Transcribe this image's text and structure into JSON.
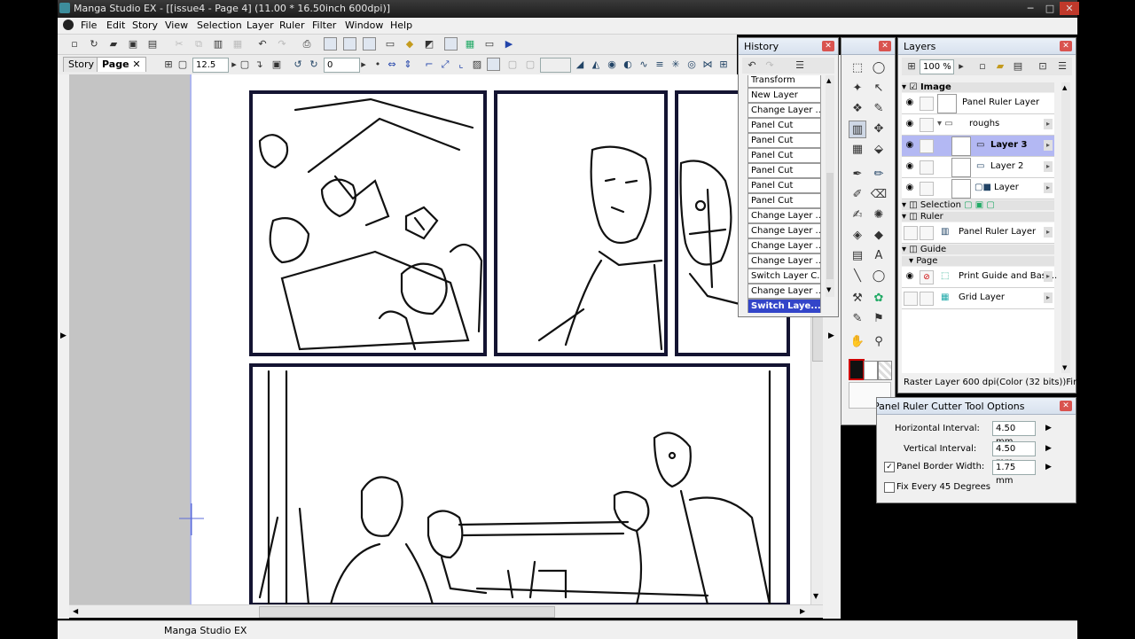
{
  "window": {
    "title": "Manga Studio EX - [[issue4 - Page 4] (11.00 * 16.50inch 600dpi)]",
    "minimize": "─",
    "maximize": "□",
    "close": "✕"
  },
  "menu": [
    "File",
    "Edit",
    "Story",
    "View",
    "Selection",
    "Layer",
    "Ruler",
    "Filter",
    "Window",
    "Help"
  ],
  "toolbar2": {
    "rotation_value": "12.5",
    "angle_value": "0"
  },
  "tabs": {
    "story": "Story",
    "page": "Page",
    "close": "✕"
  },
  "history": {
    "title": "History",
    "items": [
      "Transform",
      "New Layer",
      "Change Layer ...",
      "Panel Cut",
      "Panel Cut",
      "Panel Cut",
      "Panel Cut",
      "Panel Cut",
      "Panel Cut",
      "Change Layer ...",
      "Change Layer ...",
      "Change Layer ...",
      "Change Layer ...",
      "Switch Layer C...",
      "Change Layer ...",
      "Switch Laye..."
    ],
    "selected_index": 15
  },
  "layers": {
    "title": "Layers",
    "zoom": "100 %",
    "groups": {
      "image": "Image",
      "roughs": "roughs",
      "selection": "Selection",
      "ruler": "Ruler",
      "guide": "Guide",
      "page": "Page"
    },
    "rows": {
      "panel_ruler_layer": "Panel Ruler Layer",
      "layer3": "Layer 3",
      "layer2": "Layer 2",
      "layer": "Layer",
      "ruler_panel": "Panel Ruler Layer",
      "print_guide": "Print Guide and Basi...",
      "grid": "Grid Layer"
    },
    "status": "Raster Layer 600 dpi(Color (32 bits))Fini..."
  },
  "tool_options": {
    "title": "Panel Ruler Cutter Tool Options",
    "horizontal_label": "Horizontal Interval:",
    "horizontal_value": "4.50 mm",
    "vertical_label": "Vertical Interval:",
    "vertical_value": "4.50 mm",
    "border_label": "Panel Border Width:",
    "border_value": "1.75 mm",
    "border_checked": "✓",
    "fix_label": "Fix Every 45 Degrees"
  },
  "colors": {
    "accent_selected": "#3345c9",
    "layer_selected": "#b3b8f3",
    "panel_border": "#1a1a40"
  },
  "statusbar": {
    "text": "Manga Studio EX"
  }
}
